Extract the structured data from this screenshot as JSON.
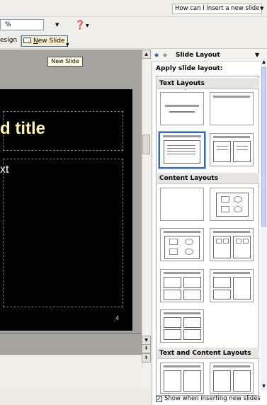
{
  "help": {
    "placeholder": "How can I insert a new slide"
  },
  "toolbar": {
    "zoom_value": "%",
    "design_label": "esign",
    "new_slide_label_pre": "",
    "new_slide_label_u": "N",
    "new_slide_label_post": "ew Slide"
  },
  "tooltip": {
    "text": "New Slide"
  },
  "slide": {
    "title": "d title",
    "body": "xt",
    "page_number": "4"
  },
  "task_pane": {
    "title": "Slide Layout",
    "apply_label": "Apply slide layout:",
    "sections": [
      "Text Layouts",
      "Content Layouts",
      "Text and Content Layouts"
    ],
    "show_checkbox_label": "Show when inserting new slides",
    "show_checked": true
  },
  "colors": {
    "accent": "#3069c6",
    "slide_bg": "#000000",
    "title_color": "#fff4a8"
  },
  "icons": [
    "help-icon",
    "new-slide-icon",
    "back-arrow-icon",
    "forward-arrow-icon",
    "close-dropdown-icon",
    "check-icon"
  ]
}
